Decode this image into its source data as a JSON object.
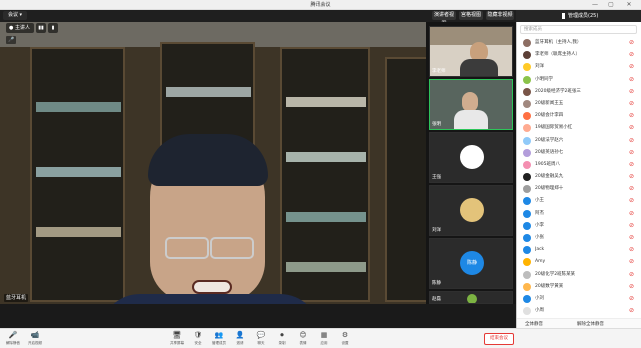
{
  "window": {
    "title": "腾讯会议",
    "minimize_icon": "—",
    "maximize_icon": "▢",
    "close_icon": "✕"
  },
  "topbar": {
    "left_button": "会议 ▾",
    "layout_buttons": [
      "▮▮",
      "▮"
    ],
    "right_tabs": [
      "演讲者视图",
      "宫格视图",
      "隐藏非视频"
    ],
    "panel_title": "管理成员(25)"
  },
  "main_video": {
    "host_label": "主讲人",
    "speaker_name": "蓝牙耳机",
    "toolbar_icon": "●"
  },
  "thumbnails": [
    {
      "label": "李老师",
      "kind": "video"
    },
    {
      "label": "张明",
      "kind": "video"
    },
    {
      "label": "王强",
      "kind": "avatar",
      "avatar_color": "#ffffff"
    },
    {
      "label": "刘洋",
      "kind": "avatar",
      "avatar_color": "#e3c37a"
    },
    {
      "label": "陈静",
      "kind": "avatar",
      "avatar_color": "#1e88e5",
      "avatar_text": "陈静"
    },
    {
      "label": "赵磊",
      "kind": "avatar",
      "avatar_color": "#7cb342"
    }
  ],
  "participants": {
    "search_placeholder": "搜索成员",
    "rows": [
      {
        "name": "蓝牙耳机（主持人,我）",
        "color": "#8d6e63"
      },
      {
        "name": "李老师（联席主持人）",
        "color": "#5d4037"
      },
      {
        "name": "刘洋",
        "color": "#ffca28"
      },
      {
        "name": "小明同学",
        "color": "#8bc34a"
      },
      {
        "name": "2020级经济学2班张三",
        "color": "#795548"
      },
      {
        "name": "20级新闻王五",
        "color": "#a1887f"
      },
      {
        "name": "20级会计李四",
        "color": "#ff7043"
      },
      {
        "name": "19级国际贸易小红",
        "color": "#ffab91"
      },
      {
        "name": "20级法学赵六",
        "color": "#90caf9"
      },
      {
        "name": "20级英语孙七",
        "color": "#b39ddb"
      },
      {
        "name": "1905班周八",
        "color": "#f48fb1"
      },
      {
        "name": "20级金融吴九",
        "color": "#212121"
      },
      {
        "name": "20级物理郑十",
        "color": "#9e9e9e"
      },
      {
        "name": "小王",
        "color": "#1e88e5"
      },
      {
        "name": "阿杰",
        "color": "#1e88e5"
      },
      {
        "name": "小李",
        "color": "#1e88e5"
      },
      {
        "name": "小张",
        "color": "#1e88e5"
      },
      {
        "name": "Jack",
        "color": "#1e88e5"
      },
      {
        "name": "Amy",
        "color": "#ffb300"
      },
      {
        "name": "20级化学2班陈某某",
        "color": "#bdbdbd"
      },
      {
        "name": "20级数学黄某",
        "color": "#ffb74d"
      },
      {
        "name": "小刘",
        "color": "#1e88e5"
      },
      {
        "name": "小周",
        "color": "#e0e0e0"
      }
    ],
    "footer_left": "全体静音",
    "footer_right": "解除全体静音"
  },
  "bottom_toolbar": {
    "left": [
      {
        "icon": "🎤",
        "label": "解除静音"
      },
      {
        "icon": "📹",
        "label": "开启视频"
      }
    ],
    "center": [
      {
        "icon": "🖥",
        "label": "共享屏幕"
      },
      {
        "icon": "🛡",
        "label": "安全"
      },
      {
        "icon": "👥",
        "label": "管理成员"
      },
      {
        "icon": "👤",
        "label": "邀请"
      },
      {
        "icon": "💬",
        "label": "聊天"
      },
      {
        "icon": "⏺",
        "label": "录制"
      },
      {
        "icon": "😊",
        "label": "表情"
      },
      {
        "icon": "▦",
        "label": "应用"
      },
      {
        "icon": "⚙",
        "label": "设置"
      }
    ],
    "end_button": "结束会议"
  }
}
